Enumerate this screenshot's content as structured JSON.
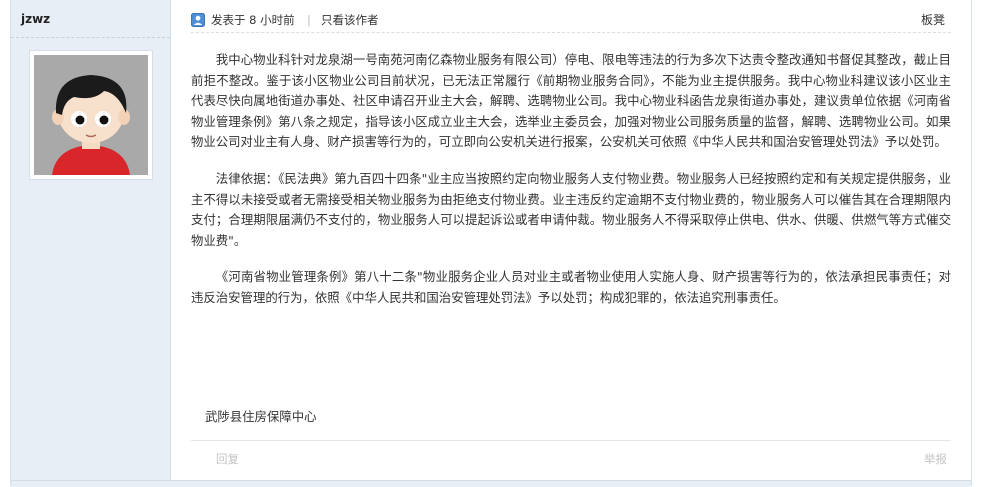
{
  "author": {
    "name": "jzwz"
  },
  "post_meta": {
    "posted_label": "发表于 8 小时前",
    "separator": "|",
    "only_author": "只看该作者",
    "floor": "板凳"
  },
  "content": {
    "paragraphs": [
      "我中心物业科针对龙泉湖一号南苑河南亿森物业服务有限公司）停电、限电等违法的行为多次下达责令整改通知书督促其整改，截止目前拒不整改。鉴于该小区物业公司目前状况，已无法正常履行《前期物业服务合同》，不能为业主提供服务。我中心物业科建议该小区业主代表尽快向属地街道办事处、社区申请召开业主大会，解聘、选聘物业公司。我中心物业科函告龙泉街道办事处，建议贵单位依据《河南省物业管理条例》第八条之规定，指导该小区成立业主大会，选举业主委员会，加强对物业公司服务质量的监督，解聘、选聘物业公司。如果物业公司对业主有人身、财产损害等行为的，可立即向公安机关进行报案，公安机关可依照《中华人民共和国治安管理处罚法》予以处罚。",
      "法律依据：《民法典》第九百四十四条\"业主应当按照约定向物业服务人支付物业费。物业服务人已经按照约定和有关规定提供服务，业主不得以未接受或者无需接受相关物业服务为由拒绝支付物业费。业主违反约定逾期不支付物业费的，物业服务人可以催告其在合理期限内支付；合理期限届满仍不支付的，物业服务人可以提起诉讼或者申请仲裁。物业服务人不得采取停止供电、供水、供暖、供燃气等方式催交物业费\"。",
      "《河南省物业管理条例》第八十二条\"物业服务企业人员对业主或者物业使用人实施人身、财产损害等行为的，依法承担民事责任；对违反治安管理的行为，依照《中华人民共和国治安管理处罚法》予以处罚；构成犯罪的，依法追究刑事责任。"
    ],
    "signature": "武陟县住房保障中心"
  },
  "footer": {
    "reply": "回复",
    "report": "举报"
  },
  "colors": {
    "sidebar_bg": "#e8eef5",
    "text": "#333333",
    "muted_link": "#c3c3c3"
  },
  "icons": {
    "meta": "user-icon",
    "avatar": "cartoon-boy-avatar"
  }
}
